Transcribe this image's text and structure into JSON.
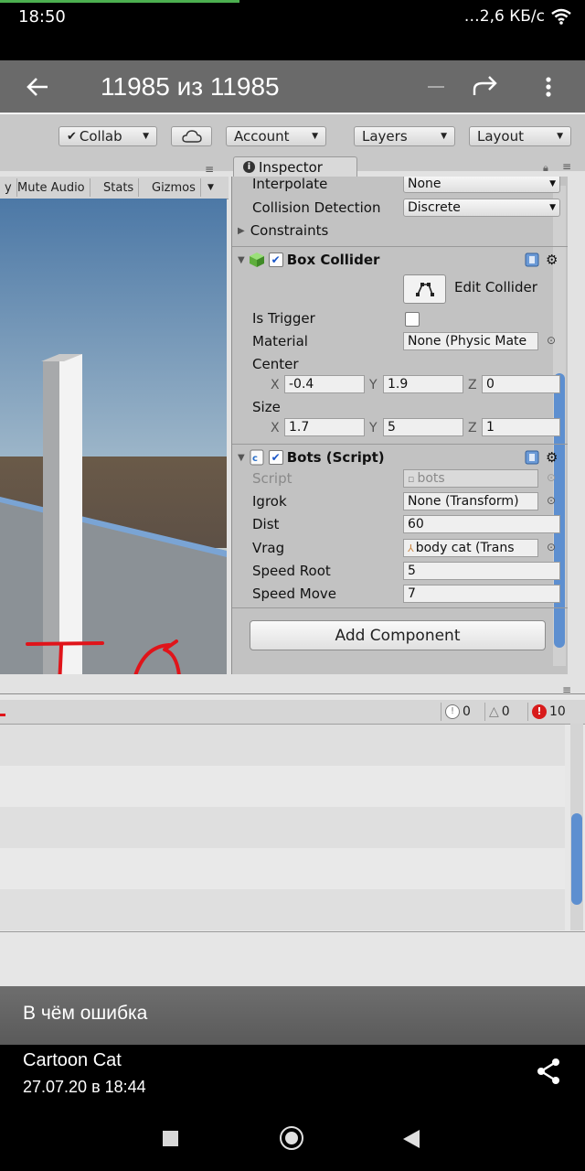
{
  "status_bar": {
    "time": "18:50",
    "network": "…2,6 КБ/с",
    "wifi_icon": "wifi-icon"
  },
  "viewer": {
    "title": "11985 из 11985",
    "icons": [
      "back-arrow-icon",
      "minus-icon",
      "forward-icon",
      "kebab-icon"
    ]
  },
  "unity_toolbar": {
    "collab": "Collab",
    "account": "Account",
    "layers": "Layers",
    "layout": "Layout"
  },
  "scene_bar": {
    "items": [
      "y",
      "Mute Audio",
      "Stats",
      "Gizmos"
    ]
  },
  "inspector": {
    "tab": "Inspector",
    "rigidbody": {
      "interpolate_label": "Interpolate",
      "interpolate_value": "None",
      "collision_label": "Collision Detection",
      "collision_value": "Discrete",
      "constraints_label": "Constraints"
    },
    "box_collider": {
      "title": "Box Collider",
      "edit_label": "Edit Collider",
      "is_trigger_label": "Is Trigger",
      "material_label": "Material",
      "material_value": "None (Physic Mate",
      "center_label": "Center",
      "center": {
        "x": "-0.4",
        "y": "1.9",
        "z": "0"
      },
      "size_label": "Size",
      "size": {
        "x": "1.7",
        "y": "5",
        "z": "1"
      },
      "axis": {
        "x": "X",
        "y": "Y",
        "z": "Z"
      }
    },
    "bots_script": {
      "title": "Bots (Script)",
      "script_label": "Script",
      "script_value": "bots",
      "igrok_label": "Igrok",
      "igrok_value": "None (Transform)",
      "dist_label": "Dist",
      "dist_value": "60",
      "vrag_label": "Vrag",
      "vrag_value": "body cat (Trans",
      "speed_root_label": "Speed Root",
      "speed_root_value": "5",
      "speed_move_label": "Speed Move",
      "speed_move_value": "7"
    },
    "add_component": "Add Component"
  },
  "console": {
    "info_count": "0",
    "warn_count": "0",
    "error_count": "10"
  },
  "post": {
    "caption": "В чём ошибка",
    "author": "Cartoon Cat",
    "date": "27.07.20 в 18:44"
  },
  "colors": {
    "scribble": "#e0141a",
    "unity_blue": "#5d8fd0",
    "error_red": "#d81b1b"
  }
}
